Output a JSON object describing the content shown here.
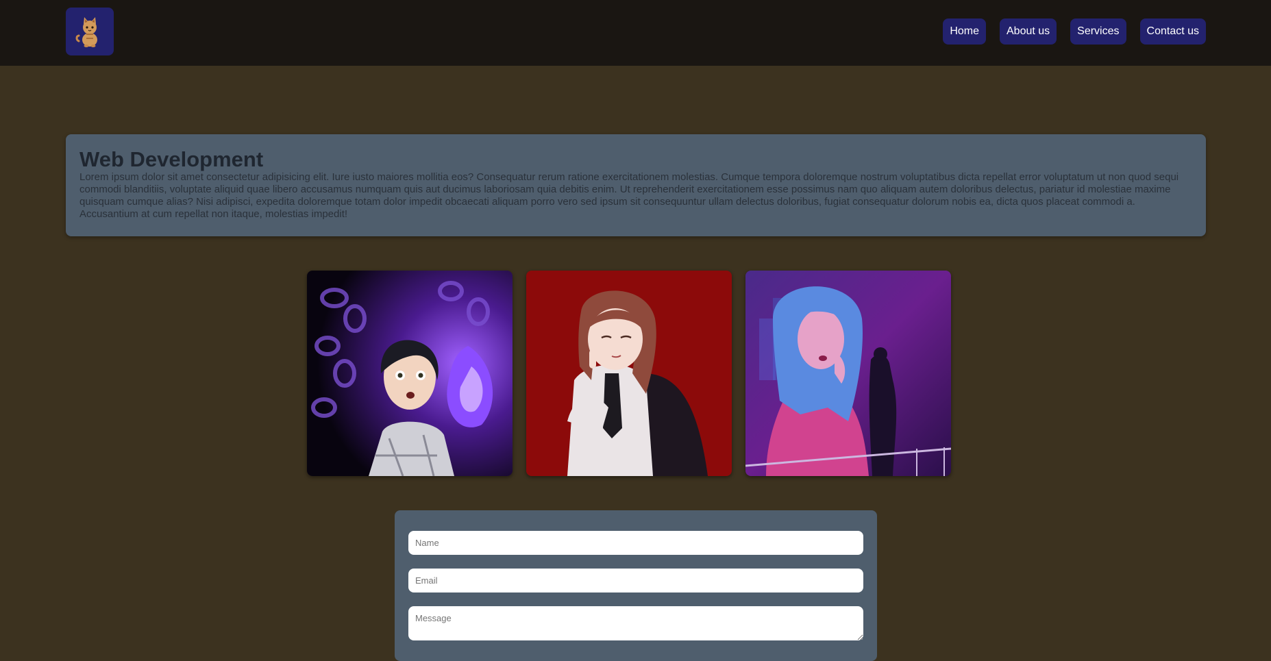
{
  "header": {
    "logo_icon": "cat-icon",
    "nav": [
      {
        "label": "Home"
      },
      {
        "label": "About us"
      },
      {
        "label": "Services"
      },
      {
        "label": "Contact us"
      }
    ]
  },
  "main": {
    "title": "Web Development",
    "body": "Lorem ipsum dolor sit amet consectetur adipisicing elit. Iure iusto maiores mollitia eos? Consequatur rerum ratione exercitationem molestias. Cumque tempora doloremque nostrum voluptatibus dicta repellat error voluptatum ut non quod sequi commodi blanditiis, voluptate aliquid quae libero accusamus numquam quis aut ducimus laboriosam quia debitis enim. Ut reprehenderit exercitationem esse possimus nam quo aliquam autem doloribus delectus, pariatur id molestiae maxime quisquam cumque alias? Nisi adipisci, expedita doloremque totam dolor impedit obcaecati aliquam porro vero sed ipsum sit consequuntur ullam delectus doloribus, fugiat consequatur dolorum nobis ea, dicta quos placeat commodi a. Accusantium at cum repellat non itaque, molestias impedit!"
  },
  "gallery": [
    {
      "icon": "anime-character-purple-flame-image"
    },
    {
      "icon": "anime-character-red-background-image"
    },
    {
      "icon": "neon-woman-blue-hair-image"
    }
  ],
  "form": {
    "name_placeholder": "Name",
    "email_placeholder": "Email",
    "message_placeholder": "Message"
  },
  "colors": {
    "background": "#3c321f",
    "header": "#1a1612",
    "accent": "#23226e",
    "card": "#4f5e6d"
  }
}
